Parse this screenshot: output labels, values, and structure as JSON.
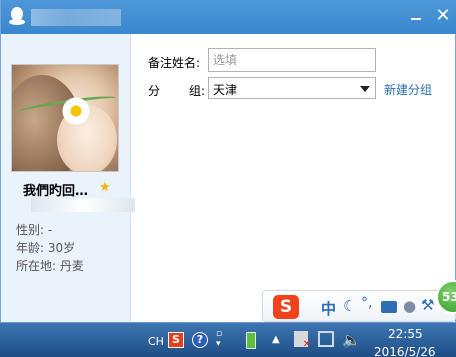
{
  "contact": {
    "nickname": "我們旳回…",
    "gender_label": "性别: -",
    "age_label": "年龄: 30岁",
    "location_label": "所在地: 丹麦"
  },
  "form": {
    "remark_label": "备注姓名:",
    "remark_placeholder": "选填",
    "group_label_a": "分",
    "group_label_b": "组:",
    "group_value": "天津",
    "new_group_link": "新建分组"
  },
  "window_controls": {
    "close": "✕"
  },
  "ime": {
    "logo": "S",
    "mode": "中",
    "punct": "°,",
    "badge": "53"
  },
  "taskbar": {
    "lang": "CH",
    "sogou": "S",
    "help": "?",
    "time": "22:55",
    "date": "2016/5/26"
  },
  "colors": {
    "titlebar": "#3a87cf",
    "link": "#2a6fb8",
    "star": "#f3b500",
    "ime_logo": "#f0421c",
    "badge": "#2f9a29"
  },
  "icons": [
    "qq-logo-icon",
    "minimize-icon",
    "close-icon",
    "star-icon",
    "dropdown-arrow-icon",
    "sogou-icon",
    "moon-icon",
    "keyboard-icon",
    "user-icon",
    "wrench-icon",
    "help-icon",
    "battery-icon",
    "flag-icon",
    "network-icon",
    "volume-icon"
  ]
}
